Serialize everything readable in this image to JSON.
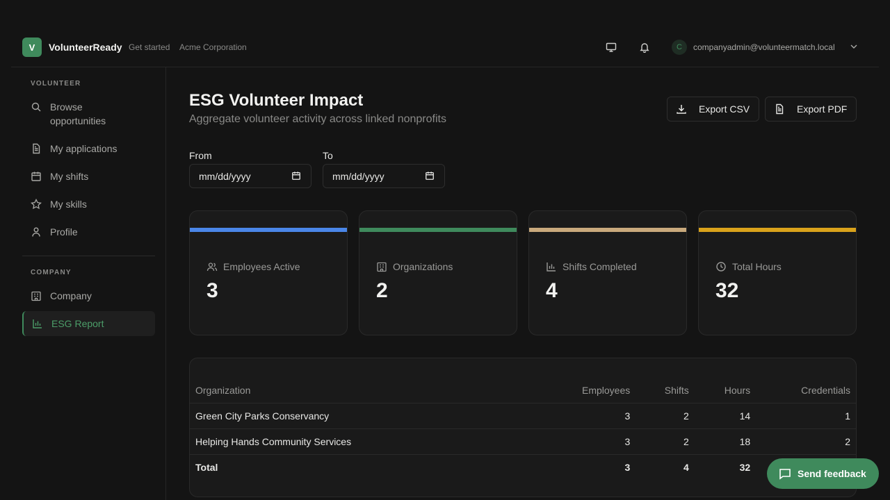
{
  "app": {
    "logo_letter": "V",
    "name": "VolunteerReady",
    "crumb_get_started": "Get started",
    "crumb_org": "Acme Corporation"
  },
  "user": {
    "initial": "C",
    "email": "companyadmin@volunteermatch.local"
  },
  "sidebar": {
    "volunteer_label": "VOLUNTEER",
    "company_label": "COMPANY",
    "items": [
      {
        "label": "Browse opportunities",
        "icon": "search-icon"
      },
      {
        "label": "My applications",
        "icon": "document-icon"
      },
      {
        "label": "My shifts",
        "icon": "calendar-icon"
      },
      {
        "label": "My skills",
        "icon": "star-icon"
      },
      {
        "label": "Profile",
        "icon": "user-icon"
      },
      {
        "label": "Company",
        "icon": "building-icon"
      },
      {
        "label": "ESG Report",
        "icon": "bar-chart-icon",
        "active": true
      }
    ]
  },
  "page": {
    "title": "ESG Volunteer Impact",
    "subtitle": "Aggregate volunteer activity across linked nonprofits"
  },
  "actions": {
    "export_csv": "Export CSV",
    "export_pdf": "Export PDF"
  },
  "filters": {
    "from_label": "From",
    "to_label": "To",
    "from_placeholder": "mm/dd/yyyy",
    "to_placeholder": "mm/dd/yyyy"
  },
  "stats": [
    {
      "label": "Employees Active",
      "value": "3",
      "color": "#4a86e8",
      "icon": "users-icon"
    },
    {
      "label": "Organizations",
      "value": "2",
      "color": "#3f8a5c",
      "icon": "building-icon"
    },
    {
      "label": "Shifts Completed",
      "value": "4",
      "color": "#c9a97c",
      "icon": "bar-chart-icon"
    },
    {
      "label": "Total Hours",
      "value": "32",
      "color": "#d9a21b",
      "icon": "clock-icon"
    }
  ],
  "table": {
    "headers": [
      "Organization",
      "Employees",
      "Shifts",
      "Hours",
      "Credentials"
    ],
    "rows": [
      [
        "Green City Parks Conservancy",
        "3",
        "2",
        "14",
        "1"
      ],
      [
        "Helping Hands Community Services",
        "3",
        "2",
        "18",
        "2"
      ]
    ],
    "total": [
      "Total",
      "3",
      "4",
      "32",
      ""
    ]
  },
  "feedback": {
    "label": "Send feedback"
  },
  "colors": {
    "accent": "#3f8a5c",
    "background": "#141414"
  }
}
